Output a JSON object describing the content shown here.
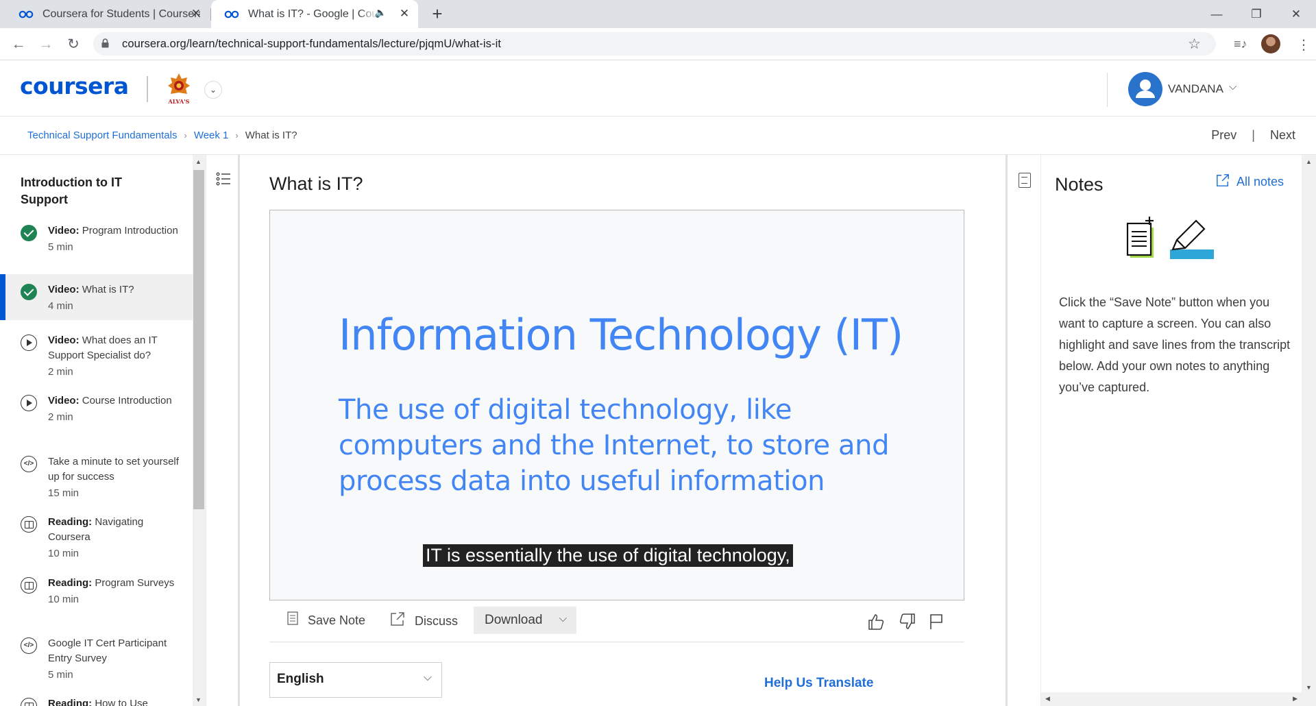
{
  "browser": {
    "tabs": [
      {
        "title": "Coursera for Students | Coursera",
        "active": false
      },
      {
        "title": "What is IT? - Google | Coursera",
        "active": true,
        "audio": true
      }
    ],
    "url": "coursera.org/learn/technical-support-fundamentals/lecture/pjqmU/what-is-it"
  },
  "header": {
    "logo": "coursera",
    "partner_logo_text": "ALVA'S",
    "user_name": "VANDANA"
  },
  "breadcrumb": {
    "items": [
      "Technical Support Fundamentals",
      "Week 1"
    ],
    "current": "What is IT?",
    "prev_label": "Prev",
    "next_label": "Next"
  },
  "sidebar": {
    "title": "Introduction to IT Support",
    "items": [
      {
        "type": "Video:",
        "name": "Program Introduction",
        "duration": "5 min",
        "icon": "check-icon",
        "active": false
      },
      {
        "type": "Video:",
        "name": "What is IT?",
        "duration": "4 min",
        "icon": "check-icon",
        "active": true
      },
      {
        "type": "Video:",
        "name": "What does an IT Support Specialist do?",
        "duration": "2 min",
        "icon": "play-icon",
        "active": false
      },
      {
        "type": "Video:",
        "name": "Course Introduction",
        "duration": "2 min",
        "icon": "play-icon",
        "active": false
      },
      {
        "type": "",
        "name": "Take a minute to set yourself up for success",
        "duration": "15 min",
        "icon": "code-icon",
        "active": false
      },
      {
        "type": "Reading:",
        "name": "Navigating Coursera",
        "duration": "10 min",
        "icon": "book-icon",
        "active": false
      },
      {
        "type": "Reading:",
        "name": "Program Surveys",
        "duration": "10 min",
        "icon": "book-icon",
        "active": false
      },
      {
        "type": "",
        "name": "Google IT Cert Participant Entry Survey",
        "duration": "5 min",
        "icon": "code-icon",
        "active": false
      },
      {
        "type": "Reading:",
        "name": "How to Use",
        "duration": "",
        "icon": "book-icon",
        "active": false
      }
    ]
  },
  "main": {
    "title": "What is IT?",
    "video": {
      "slide_heading": "Information Technology (IT)",
      "slide_body": "The use of digital technology, like computers and the Internet, to store and process data into useful information",
      "caption": "IT is essentially the use of digital technology,"
    },
    "actions": {
      "save_note": "Save Note",
      "discuss": "Discuss",
      "download": "Download"
    },
    "language": "English",
    "help_translate": "Help Us Translate"
  },
  "notes": {
    "title": "Notes",
    "all_notes": "All notes",
    "description": "Click the “Save Note” button when you want to capture a screen. You can also highlight and save lines from the transcript below. Add your own notes to anything you’ve captured."
  },
  "colors": {
    "brand": "#0056d2",
    "slide_blue": "#4285f4",
    "complete_green": "#1f8354",
    "link": "#1f6fd6"
  }
}
